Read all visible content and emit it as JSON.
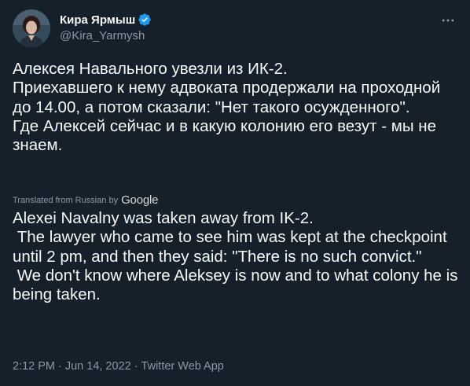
{
  "author": {
    "display_name": "Кира Ярмыш",
    "handle": "@Kira_Yarmysh",
    "verified": true,
    "avatar_icon": "avatar-photo"
  },
  "tweet": {
    "text": "Алексея Навального увезли из ИК-2.\nПриехавшего к нему адвоката продержали на проходной до 14.00, а потом сказали: \"Нет такого осужденного\".\nГде Алексей сейчас и в какую колонию его везут - мы не знаем.",
    "translated_from_label": "Translated from Russian by",
    "translation_provider": "Google",
    "translation": "Alexei Navalny was taken away from IK-2.\n The lawyer who came to see him was kept at the checkpoint until 2 pm, and then they said: \"There is no such convict.\"\n We don't know where Aleksey is now and to what colony he is being taken."
  },
  "meta": {
    "time": "2:12 PM",
    "separator": "·",
    "date": "Jun 14, 2022",
    "source": "Twitter Web App"
  },
  "colors": {
    "background": "#15202b",
    "text": "#f7f9f9",
    "secondary": "#8b98a5",
    "verified": "#1d9bf0"
  },
  "icons": {
    "verified": "verified-badge-icon",
    "more": "more-horizontal-icon"
  }
}
